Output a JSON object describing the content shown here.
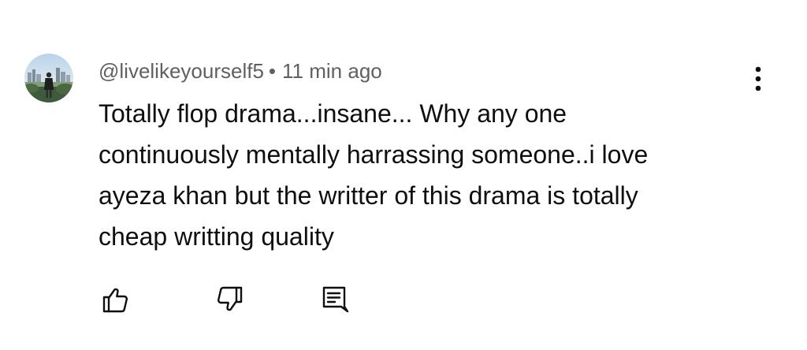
{
  "comment": {
    "author": "@livelikeyourself5",
    "separator": "•",
    "time": "11 min ago",
    "lines": [
      "Totally flop drama...insane... Why any one",
      "continuously mentally harrassing someone..i love",
      "ayeza khan but the writter of this drama is totally",
      "cheap writting quality"
    ]
  },
  "actions": {
    "like_icon": "thumbs-up-icon",
    "dislike_icon": "thumbs-down-icon",
    "reply_icon": "reply-comment-icon",
    "more_icon": "more-vertical-icon"
  },
  "colors": {
    "text_primary": "#0f0f0f",
    "text_secondary": "#606060",
    "icon": "#0f0f0f"
  }
}
